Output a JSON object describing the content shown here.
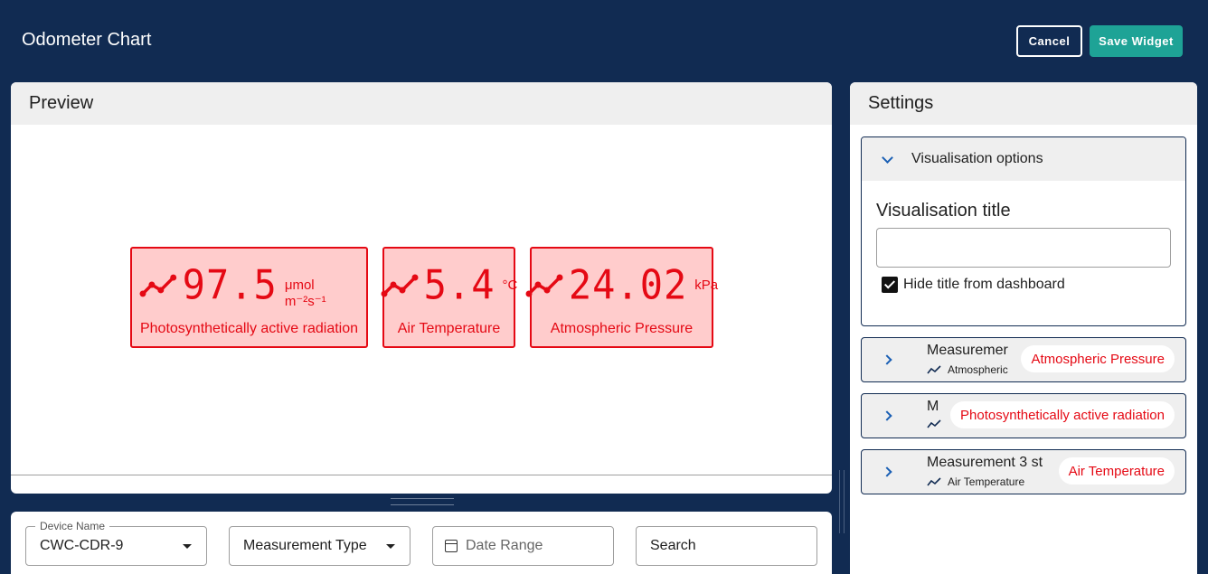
{
  "header": {
    "title": "Odometer Chart",
    "cancel_label": "Cancel",
    "save_label": "Save Widget"
  },
  "preview": {
    "title": "Preview",
    "odometers": [
      {
        "value": "97.5",
        "unit": "μmol m⁻²s⁻¹",
        "label": "Photosynthetically active radiation"
      },
      {
        "value": "5.4",
        "unit": "°C",
        "label": "Air Temperature"
      },
      {
        "value": "24.02",
        "unit": "kPa",
        "label": "Atmospheric Pressure"
      }
    ],
    "accent_color": "#e50914",
    "tile_background": "#ffcccc"
  },
  "filters": {
    "device_label": "Device Name",
    "device_value": "CWC-CDR-9",
    "measurement_type": "Measurement Type",
    "date_range": "Date Range",
    "search": "Search"
  },
  "settings": {
    "title": "Settings",
    "visualisation": {
      "section_title": "Visualisation options",
      "title_label": "Visualisation title",
      "title_value": "",
      "hide_title_label": "Hide title from dashboard",
      "hide_title_checked": true
    },
    "measurements": [
      {
        "name": "Measuremer",
        "sub": "Atmospheric",
        "chip": "Atmospheric Pressure"
      },
      {
        "name": "M",
        "sub": "",
        "chip": "Photosynthetically active radiation"
      },
      {
        "name": "Measurement 3 st",
        "sub": "Air Temperature",
        "chip": "Air Temperature"
      }
    ]
  },
  "colors": {
    "navy": "#112b52",
    "teal": "#1ea396"
  }
}
